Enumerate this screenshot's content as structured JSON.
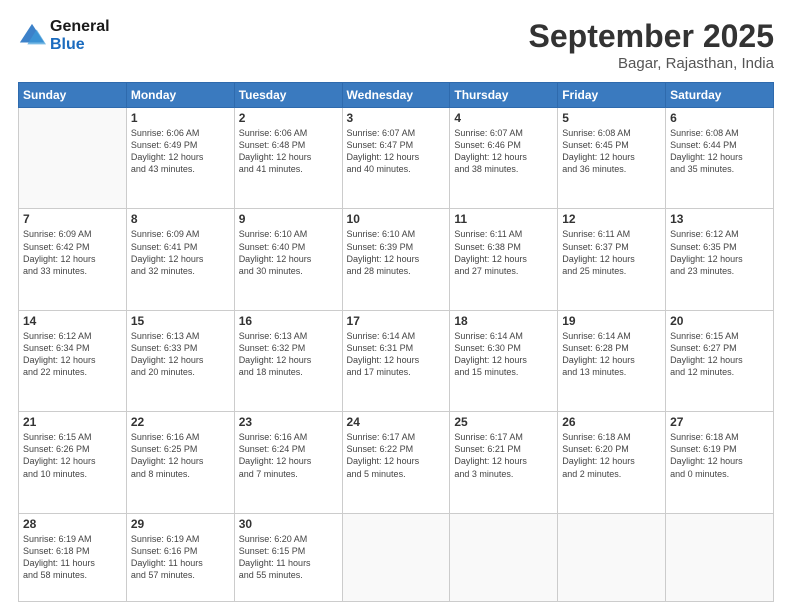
{
  "header": {
    "logo_line1": "General",
    "logo_line2": "Blue",
    "title": "September 2025",
    "subtitle": "Bagar, Rajasthan, India"
  },
  "days_of_week": [
    "Sunday",
    "Monday",
    "Tuesday",
    "Wednesday",
    "Thursday",
    "Friday",
    "Saturday"
  ],
  "weeks": [
    [
      {
        "num": "",
        "info": ""
      },
      {
        "num": "1",
        "info": "Sunrise: 6:06 AM\nSunset: 6:49 PM\nDaylight: 12 hours\nand 43 minutes."
      },
      {
        "num": "2",
        "info": "Sunrise: 6:06 AM\nSunset: 6:48 PM\nDaylight: 12 hours\nand 41 minutes."
      },
      {
        "num": "3",
        "info": "Sunrise: 6:07 AM\nSunset: 6:47 PM\nDaylight: 12 hours\nand 40 minutes."
      },
      {
        "num": "4",
        "info": "Sunrise: 6:07 AM\nSunset: 6:46 PM\nDaylight: 12 hours\nand 38 minutes."
      },
      {
        "num": "5",
        "info": "Sunrise: 6:08 AM\nSunset: 6:45 PM\nDaylight: 12 hours\nand 36 minutes."
      },
      {
        "num": "6",
        "info": "Sunrise: 6:08 AM\nSunset: 6:44 PM\nDaylight: 12 hours\nand 35 minutes."
      }
    ],
    [
      {
        "num": "7",
        "info": "Sunrise: 6:09 AM\nSunset: 6:42 PM\nDaylight: 12 hours\nand 33 minutes."
      },
      {
        "num": "8",
        "info": "Sunrise: 6:09 AM\nSunset: 6:41 PM\nDaylight: 12 hours\nand 32 minutes."
      },
      {
        "num": "9",
        "info": "Sunrise: 6:10 AM\nSunset: 6:40 PM\nDaylight: 12 hours\nand 30 minutes."
      },
      {
        "num": "10",
        "info": "Sunrise: 6:10 AM\nSunset: 6:39 PM\nDaylight: 12 hours\nand 28 minutes."
      },
      {
        "num": "11",
        "info": "Sunrise: 6:11 AM\nSunset: 6:38 PM\nDaylight: 12 hours\nand 27 minutes."
      },
      {
        "num": "12",
        "info": "Sunrise: 6:11 AM\nSunset: 6:37 PM\nDaylight: 12 hours\nand 25 minutes."
      },
      {
        "num": "13",
        "info": "Sunrise: 6:12 AM\nSunset: 6:35 PM\nDaylight: 12 hours\nand 23 minutes."
      }
    ],
    [
      {
        "num": "14",
        "info": "Sunrise: 6:12 AM\nSunset: 6:34 PM\nDaylight: 12 hours\nand 22 minutes."
      },
      {
        "num": "15",
        "info": "Sunrise: 6:13 AM\nSunset: 6:33 PM\nDaylight: 12 hours\nand 20 minutes."
      },
      {
        "num": "16",
        "info": "Sunrise: 6:13 AM\nSunset: 6:32 PM\nDaylight: 12 hours\nand 18 minutes."
      },
      {
        "num": "17",
        "info": "Sunrise: 6:14 AM\nSunset: 6:31 PM\nDaylight: 12 hours\nand 17 minutes."
      },
      {
        "num": "18",
        "info": "Sunrise: 6:14 AM\nSunset: 6:30 PM\nDaylight: 12 hours\nand 15 minutes."
      },
      {
        "num": "19",
        "info": "Sunrise: 6:14 AM\nSunset: 6:28 PM\nDaylight: 12 hours\nand 13 minutes."
      },
      {
        "num": "20",
        "info": "Sunrise: 6:15 AM\nSunset: 6:27 PM\nDaylight: 12 hours\nand 12 minutes."
      }
    ],
    [
      {
        "num": "21",
        "info": "Sunrise: 6:15 AM\nSunset: 6:26 PM\nDaylight: 12 hours\nand 10 minutes."
      },
      {
        "num": "22",
        "info": "Sunrise: 6:16 AM\nSunset: 6:25 PM\nDaylight: 12 hours\nand 8 minutes."
      },
      {
        "num": "23",
        "info": "Sunrise: 6:16 AM\nSunset: 6:24 PM\nDaylight: 12 hours\nand 7 minutes."
      },
      {
        "num": "24",
        "info": "Sunrise: 6:17 AM\nSunset: 6:22 PM\nDaylight: 12 hours\nand 5 minutes."
      },
      {
        "num": "25",
        "info": "Sunrise: 6:17 AM\nSunset: 6:21 PM\nDaylight: 12 hours\nand 3 minutes."
      },
      {
        "num": "26",
        "info": "Sunrise: 6:18 AM\nSunset: 6:20 PM\nDaylight: 12 hours\nand 2 minutes."
      },
      {
        "num": "27",
        "info": "Sunrise: 6:18 AM\nSunset: 6:19 PM\nDaylight: 12 hours\nand 0 minutes."
      }
    ],
    [
      {
        "num": "28",
        "info": "Sunrise: 6:19 AM\nSunset: 6:18 PM\nDaylight: 11 hours\nand 58 minutes."
      },
      {
        "num": "29",
        "info": "Sunrise: 6:19 AM\nSunset: 6:16 PM\nDaylight: 11 hours\nand 57 minutes."
      },
      {
        "num": "30",
        "info": "Sunrise: 6:20 AM\nSunset: 6:15 PM\nDaylight: 11 hours\nand 55 minutes."
      },
      {
        "num": "",
        "info": ""
      },
      {
        "num": "",
        "info": ""
      },
      {
        "num": "",
        "info": ""
      },
      {
        "num": "",
        "info": ""
      }
    ]
  ]
}
